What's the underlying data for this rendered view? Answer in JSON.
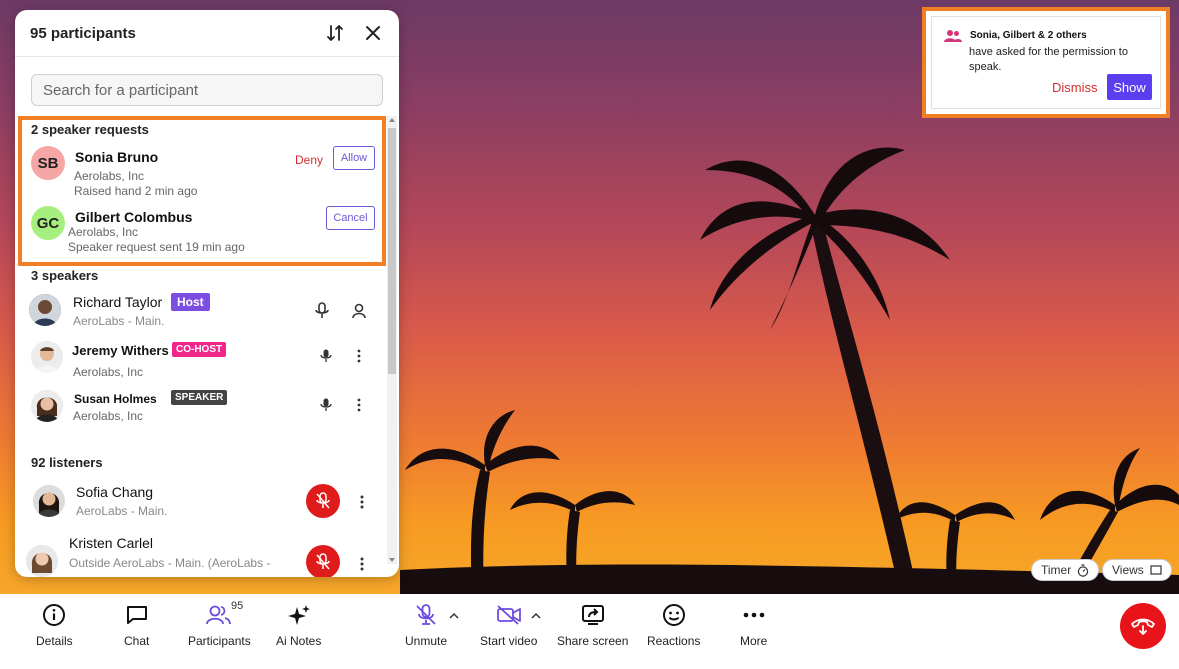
{
  "panel": {
    "title": "95 participants",
    "search_placeholder": "Search for a participant"
  },
  "requests": {
    "title": "2 speaker requests",
    "items": [
      {
        "initials": "SB",
        "name": "Sonia Bruno",
        "org": "Aerolabs, Inc",
        "status": "Raised hand 2 min ago",
        "deny_label": "Deny",
        "allow_label": "Allow",
        "avatar_color": "#f7a6a6"
      },
      {
        "initials": "GC",
        "name": "Gilbert Colombus",
        "org": "Aerolabs, Inc",
        "status": "Speaker request sent 19 min ago",
        "cancel_label": "Cancel",
        "avatar_color": "#a6ee7e"
      }
    ]
  },
  "speakers": {
    "title": "3 speakers",
    "items": [
      {
        "name": "Richard Taylor",
        "role": "Host",
        "org": "AeroLabs - Main.",
        "role_color": "#7b4de0"
      },
      {
        "name": "Jeremy Withers",
        "role": "CO-HOST",
        "org": "Aerolabs, Inc",
        "role_color": "#f0268a"
      },
      {
        "name": "Susan Holmes",
        "role": "SPEAKER",
        "org": "Aerolabs, Inc",
        "role_color": "#444444"
      }
    ]
  },
  "listeners": {
    "title": "92 listeners",
    "items": [
      {
        "name": "Sofia Chang",
        "org": "AeroLabs - Main."
      },
      {
        "name": "Kristen Carlel",
        "org": "Outside AeroLabs - Main. (AeroLabs -"
      }
    ]
  },
  "notification": {
    "title": "Sonia, Gilbert & 2 others",
    "body": "have asked for the permission to speak.",
    "dismiss_label": "Dismiss",
    "show_label": "Show"
  },
  "overlay": {
    "timer_label": "Timer",
    "views_label": "Views"
  },
  "toolbar": {
    "details": "Details",
    "chat": "Chat",
    "participants": "Participants",
    "participants_count": "95",
    "ai_notes": "Ai Notes",
    "unmute": "Unmute",
    "start_video": "Start video",
    "share_screen": "Share screen",
    "reactions": "Reactions",
    "more": "More"
  },
  "colors": {
    "accent": "#5a3ef0",
    "highlight": "#f07f26",
    "danger": "#e01b1b"
  }
}
